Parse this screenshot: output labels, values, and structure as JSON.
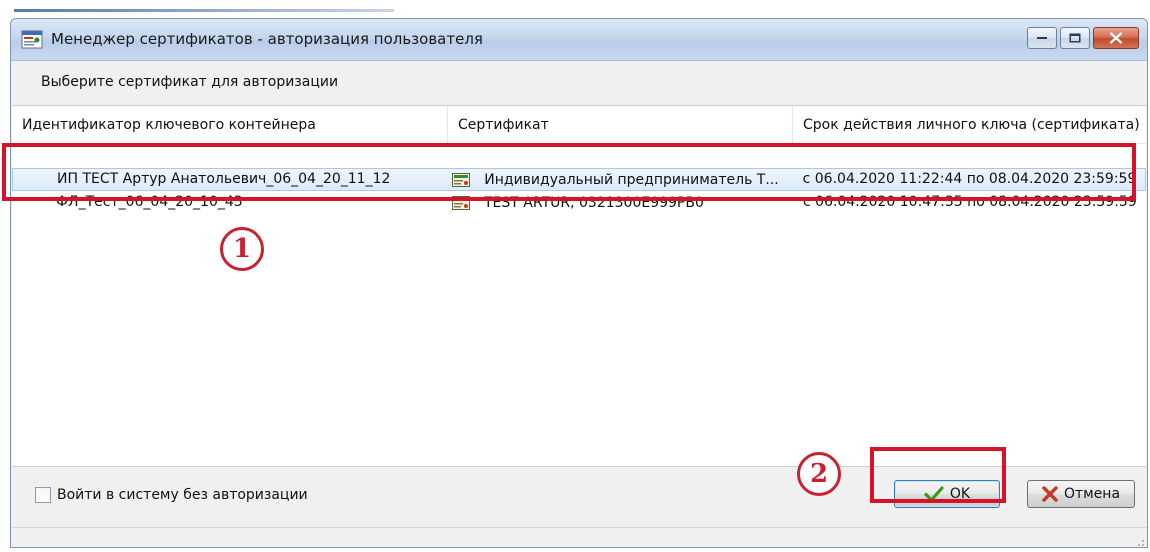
{
  "window": {
    "title": "Менеджер сертификатов - авторизация пользователя",
    "icon": "certificate-manager-icon"
  },
  "prompt": "Выберите сертификат для авторизации",
  "table": {
    "columns": [
      "Идентификатор ключевого контейнера",
      "Сертификат",
      "Срок действия личного ключа (сертификата)"
    ],
    "rows": [
      {
        "container_id": "ИП ТЕСТ Артур Анатольевич_06_04_20_11_12",
        "certificate": "Индивидуальный предприниматель Т...",
        "validity": "с 06.04.2020 11:22:44 по 08.04.2020 23:59:59",
        "selected": true
      },
      {
        "container_id": "ФЛ_Тест_06_04_20_10_43",
        "certificate": "TEST ARTUR, 0321300E999PB0",
        "validity": "с 06.04.2020 10:47:35 по 08.04.2020 23:59:59",
        "selected": false
      }
    ]
  },
  "annotations": {
    "badge_1": "1",
    "badge_2": "2"
  },
  "footer": {
    "no_auth_checkbox_label": "Войти в систему без авторизации",
    "no_auth_checked": false,
    "ok_label": "OK",
    "cancel_label": "Отмена"
  },
  "colors": {
    "highlight": "#d6132a",
    "badge": "#c9212f",
    "ok_icon": "#3a9a1e",
    "cancel_icon": "#c23a1f"
  }
}
